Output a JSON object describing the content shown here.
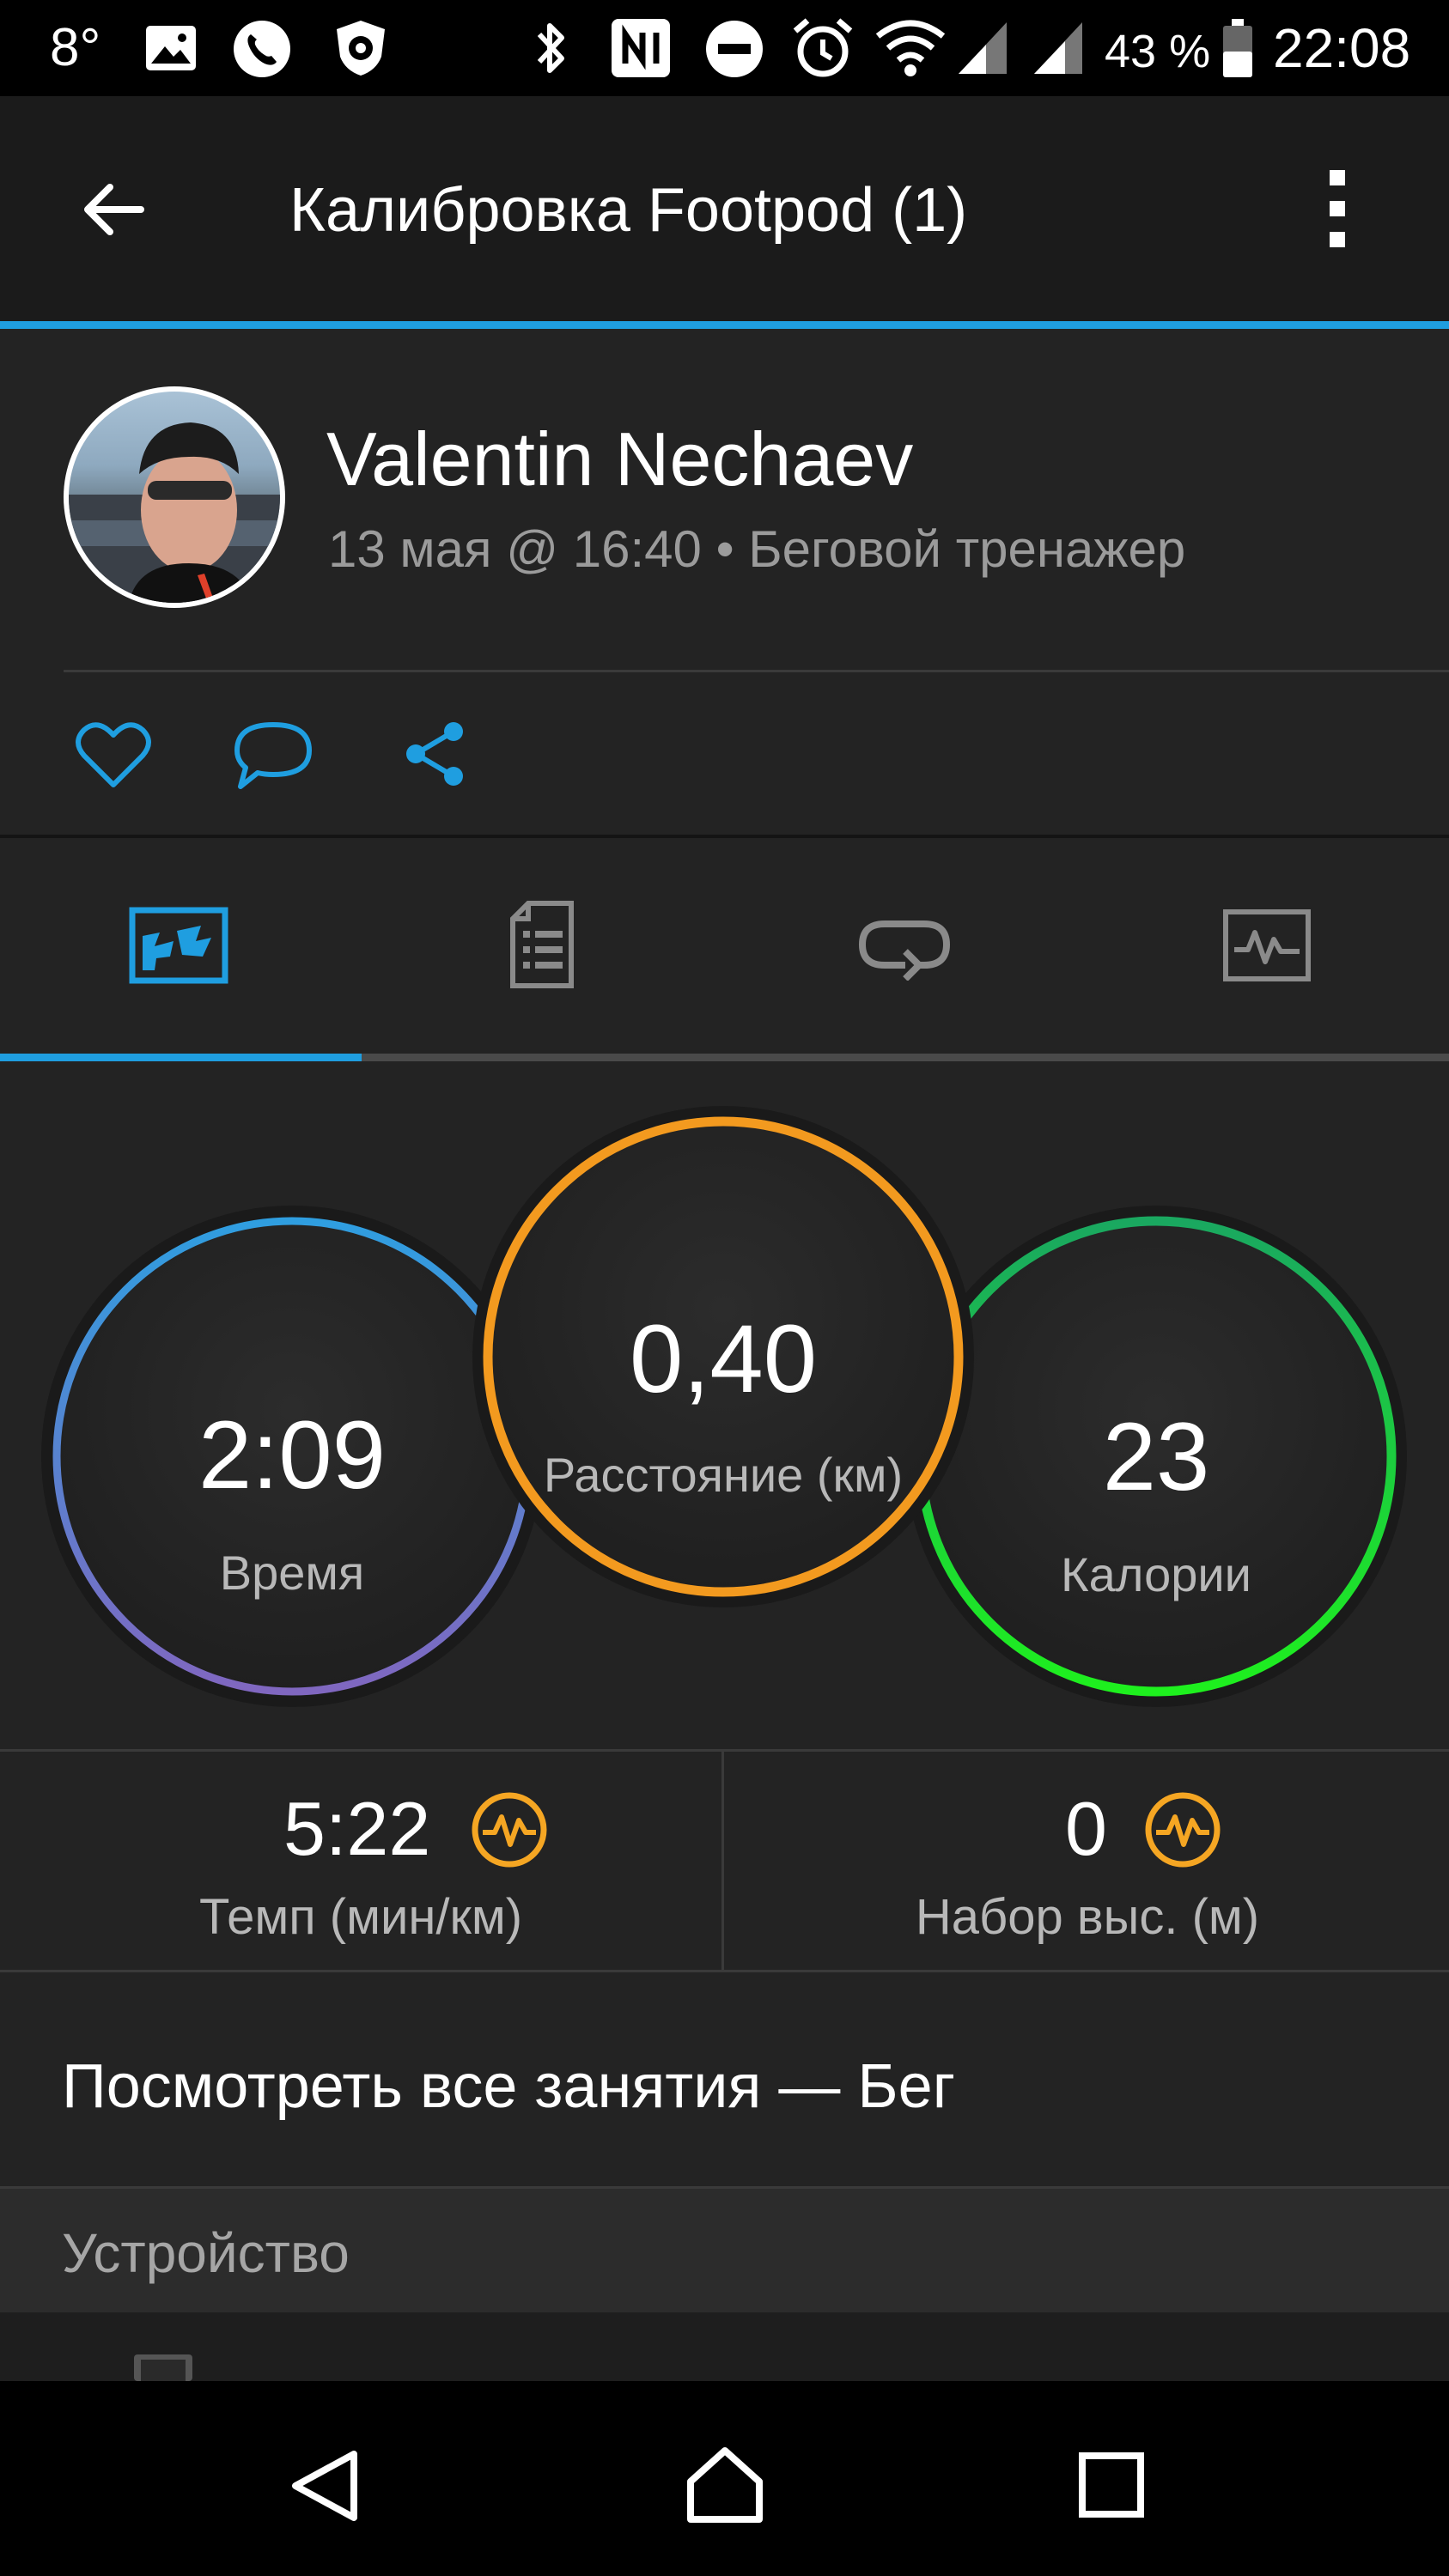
{
  "status_bar": {
    "temperature": "8°",
    "battery_percent": "43 %",
    "time": "22:08"
  },
  "toolbar": {
    "title": "Калибровка Footpod (1)"
  },
  "profile": {
    "name": "Valentin Nechaev",
    "meta": "13 мая @ 16:40 • Беговой тренажер"
  },
  "colors": {
    "accent": "#1f9ee0",
    "time_ring": "#4a8fd8",
    "distance_ring": "#f39a1f",
    "calories_ring": "#1ee51e",
    "badge": "#f5a623"
  },
  "tabs": [
    {
      "icon": "map-overview-icon",
      "active": true
    },
    {
      "icon": "details-document-icon",
      "active": false
    },
    {
      "icon": "laps-loop-icon",
      "active": false
    },
    {
      "icon": "chart-graph-icon",
      "active": false
    }
  ],
  "summary": {
    "time": {
      "value": "2:09",
      "label": "Время"
    },
    "distance": {
      "value": "0,40",
      "label": "Расстояние (км)"
    },
    "calories": {
      "value": "23",
      "label": "Калории"
    }
  },
  "stats": {
    "pace": {
      "value": "5:22",
      "label": "Темп (мин/км)",
      "badge_icon": "pulse-badge-icon"
    },
    "elevation": {
      "value": "0",
      "label": "Набор выс. (м)",
      "badge_icon": "pulse-badge-icon"
    }
  },
  "link": {
    "label": "Посмотреть все занятия — Бег"
  },
  "device_section": {
    "title": "Устройство"
  }
}
